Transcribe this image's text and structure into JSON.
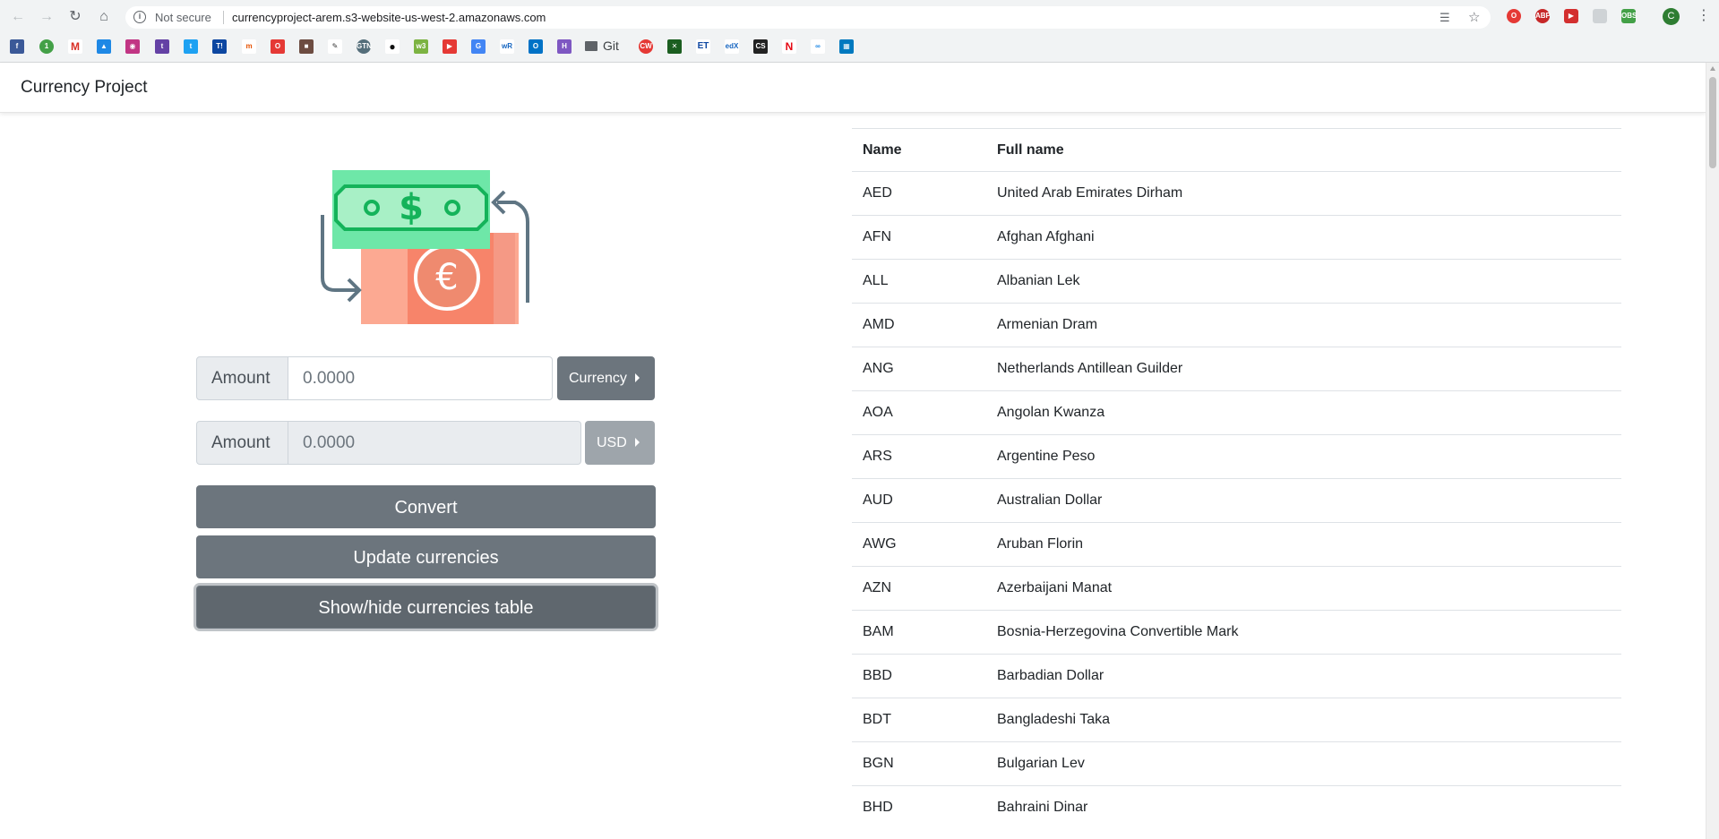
{
  "browser": {
    "security_label": "Not secure",
    "url": "currencyproject-arem.s3-website-us-west-2.amazonaws.com",
    "bookmark_folder": "Git",
    "profile_initial": "C"
  },
  "app": {
    "brand": "Currency Project"
  },
  "converter": {
    "from": {
      "label": "Amount",
      "placeholder": "0.0000",
      "currency_button": "Currency"
    },
    "to": {
      "label": "Amount",
      "placeholder": "0.0000",
      "currency_button": "USD"
    },
    "convert_label": "Convert",
    "update_label": "Update currencies",
    "toggle_label": "Show/hide currencies table"
  },
  "table": {
    "headers": [
      "Name",
      "Full name"
    ],
    "rows": [
      [
        "AED",
        "United Arab Emirates Dirham"
      ],
      [
        "AFN",
        "Afghan Afghani"
      ],
      [
        "ALL",
        "Albanian Lek"
      ],
      [
        "AMD",
        "Armenian Dram"
      ],
      [
        "ANG",
        "Netherlands Antillean Guilder"
      ],
      [
        "AOA",
        "Angolan Kwanza"
      ],
      [
        "ARS",
        "Argentine Peso"
      ],
      [
        "AUD",
        "Australian Dollar"
      ],
      [
        "AWG",
        "Aruban Florin"
      ],
      [
        "AZN",
        "Azerbaijani Manat"
      ],
      [
        "BAM",
        "Bosnia-Herzegovina Convertible Mark"
      ],
      [
        "BBD",
        "Barbadian Dollar"
      ],
      [
        "BDT",
        "Bangladeshi Taka"
      ],
      [
        "BGN",
        "Bulgarian Lev"
      ],
      [
        "BHD",
        "Bahraini Dinar"
      ]
    ]
  },
  "colors": {
    "button_gray": "#6c757d",
    "note_green": "#6ee7a8",
    "note_green_dark": "#14b35a",
    "note_red": "#fca992",
    "arrow_gray": "#5f7583"
  }
}
